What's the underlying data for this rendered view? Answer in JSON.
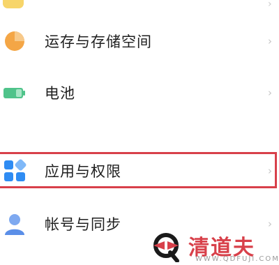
{
  "settings": {
    "items": [
      {
        "label": "运存与存储空间",
        "icon": "storage-pie-icon"
      },
      {
        "label": "电池",
        "icon": "battery-icon"
      },
      {
        "label": "应用与权限",
        "icon": "apps-grid-icon"
      },
      {
        "label": "帐号与同步",
        "icon": "account-person-icon"
      }
    ],
    "chevron": "›",
    "highlighted_item": "应用与权限"
  },
  "watermark": {
    "name": "清道夫",
    "url": "WWW.QDFUJI.COM"
  },
  "colors": {
    "highlight": "#d8404a",
    "storage_icon": "#f4a646",
    "battery_icon": "#4fc38a",
    "apps_icon": "#2f8cf3",
    "account_icon": "#5b8fe8"
  }
}
